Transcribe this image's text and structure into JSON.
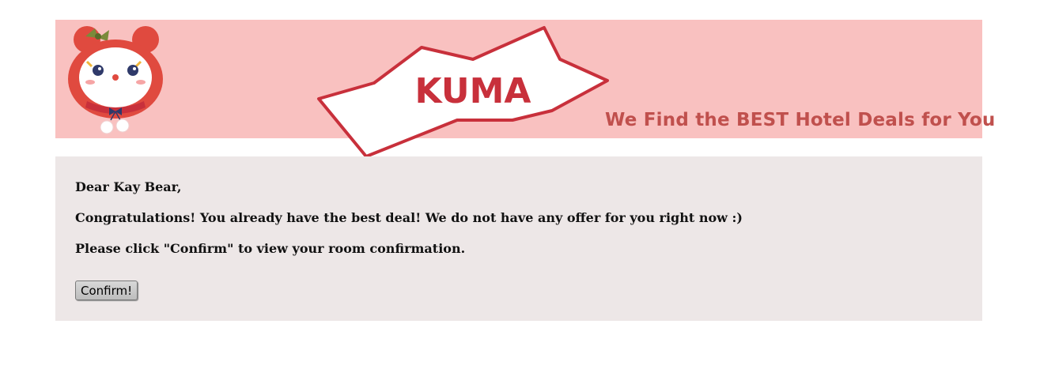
{
  "banner": {
    "brand": "KUMA",
    "tagline": "We Find the BEST Hotel Deals for You"
  },
  "message": {
    "greeting": "Dear Kay Bear,",
    "line1": "Congratulations! You already have the best deal! We do not have any offer for you right now :)",
    "line2": "Please click \"Confirm\" to view your room confirmation."
  },
  "actions": {
    "confirm_label": "Confirm!"
  },
  "colors": {
    "banner_bg": "#f9c1c0",
    "accent": "#c8303b",
    "tagline": "#c0504d",
    "content_bg": "#ede7e7"
  },
  "icons": {
    "mascot": "bear-mascot-icon"
  }
}
